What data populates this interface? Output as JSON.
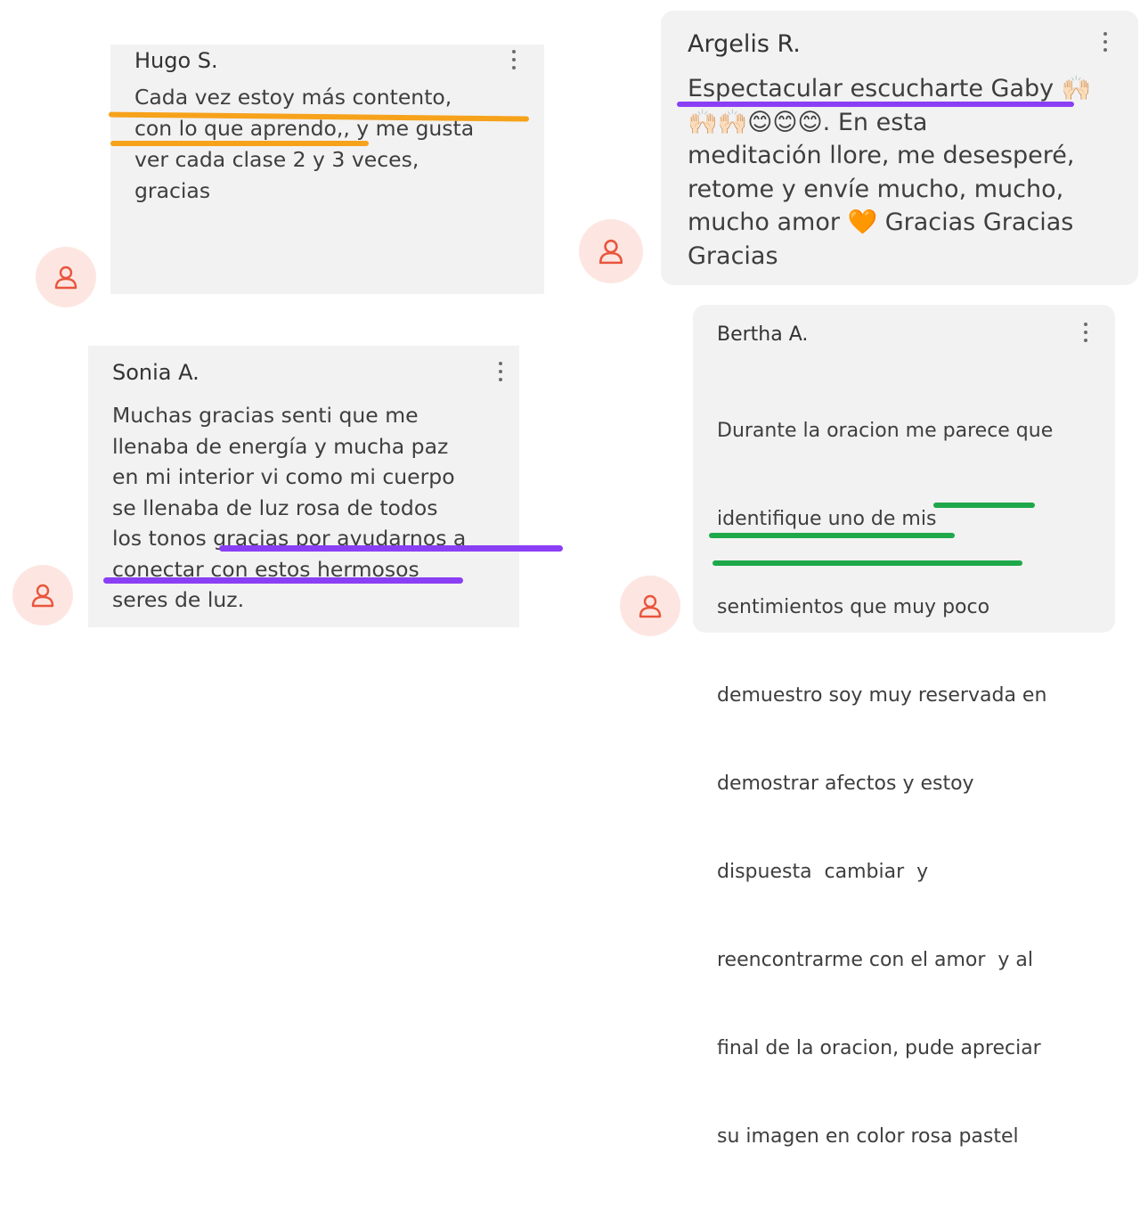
{
  "comments": [
    {
      "author": "Hugo S.",
      "lines": [
        "Cada vez estoy más contento,",
        "con lo que aprendo,, y me gusta",
        "ver cada clase 2 y 3 veces,",
        "gracias"
      ]
    },
    {
      "author": "Argelis R.",
      "lines": [
        "Espectacular escucharte Gaby 🙌🏻",
        "🙌🏻🙌🏻😊😊😊. En esta",
        "meditación llore, me desesperé,",
        "retome y envíe mucho, mucho,",
        "mucho amor 🧡 Gracias Gracias",
        "Gracias"
      ]
    },
    {
      "author": "Sonia A.",
      "lines": [
        "Muchas gracias senti que me",
        "llenaba de energía y mucha paz",
        "en mi interior vi como mi cuerpo",
        "se llenaba de luz rosa de todos",
        "los tonos gracias por ayudarnos a",
        "conectar con estos hermosos",
        "seres de luz."
      ]
    },
    {
      "author": "Bertha A.",
      "lines": [
        "Durante la oracion me parece que",
        "identifique uno de mis",
        "sentimientos que muy poco",
        "demuestro soy muy reservada en",
        "demostrar afectos y estoy",
        "dispuesta  cambiar  y",
        "reencontrarme con el amor  y al",
        "final de la oracion, pude apreciar",
        "su imagen en color rosa pastel"
      ]
    }
  ],
  "icons": {
    "avatar": "user-icon",
    "menu": "more-vertical-icon"
  },
  "colors": {
    "card_bg": "#f2f2f2",
    "avatar_bg": "#fde6e1",
    "avatar_icon": "#e9553d",
    "highlight_orange": "#f7a21b",
    "highlight_purple": "#8b3ff5",
    "highlight_green": "#1ea84a"
  }
}
